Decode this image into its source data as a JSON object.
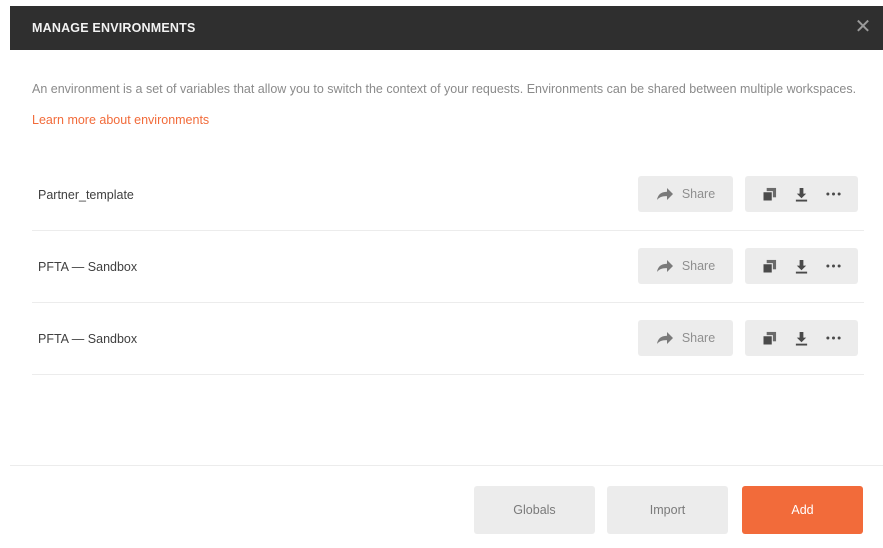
{
  "dialog": {
    "title": "MANAGE ENVIRONMENTS",
    "close_glyph": "✕"
  },
  "description": {
    "text": "An environment is a set of variables that allow you to switch the context of your requests. Environments can be shared between multiple workspaces.",
    "link_text": "Learn more about environments"
  },
  "environments": [
    {
      "name": "Partner_template",
      "share_label": "Share"
    },
    {
      "name": "PFTA — Sandbox",
      "share_label": "Share"
    },
    {
      "name": "PFTA — Sandbox",
      "share_label": "Share"
    }
  ],
  "icons": {
    "share": "share-arrow-icon",
    "duplicate": "duplicate-icon",
    "download": "download-icon",
    "more": "more-options-icon",
    "close": "close-icon"
  },
  "footer": {
    "globals_label": "Globals",
    "import_label": "Import",
    "add_label": "Add"
  },
  "colors": {
    "header_bg": "#2f2f2f",
    "accent": "#f26b3a",
    "button_bg": "#ececec"
  }
}
